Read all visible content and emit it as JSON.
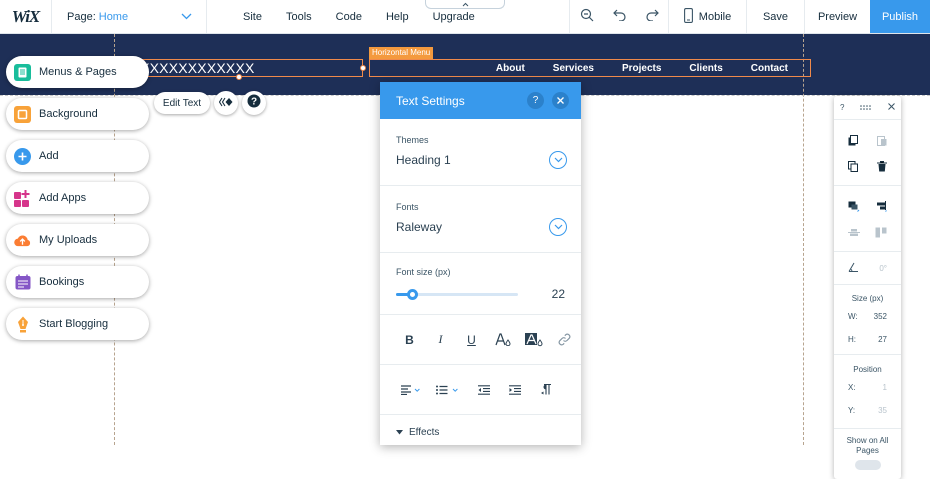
{
  "topbar": {
    "logo": "WiX",
    "page_label": "Page:",
    "page_value": "Home",
    "nav": [
      "Site",
      "Tools",
      "Code",
      "Help",
      "Upgrade"
    ],
    "mobile_label": "Mobile",
    "save_label": "Save",
    "preview_label": "Preview",
    "publish_label": "Publish"
  },
  "site": {
    "text_content": "XXXXXXXXXXXXXX",
    "menu_tag": "Horizontal Menu",
    "menu_items": [
      "About",
      "Services",
      "Projects",
      "Clients",
      "Contact"
    ]
  },
  "floating": {
    "edit_text_label": "Edit Text"
  },
  "left_menu": {
    "items": [
      {
        "label": "Menus & Pages",
        "icon": "pages-icon",
        "color": "#19bd9b"
      },
      {
        "label": "Background",
        "icon": "background-icon",
        "color": "#f8a239"
      },
      {
        "label": "Add",
        "icon": "plus-icon",
        "color": "#3899ec"
      },
      {
        "label": "Add Apps",
        "icon": "apps-icon",
        "color": "#d6358b"
      },
      {
        "label": "My Uploads",
        "icon": "upload-icon",
        "color": "#fb7d33"
      },
      {
        "label": "Bookings",
        "icon": "calendar-icon",
        "color": "#8456c6"
      },
      {
        "label": "Start Blogging",
        "icon": "pen-icon",
        "color": "#f8a239"
      }
    ]
  },
  "text_settings": {
    "title": "Text Settings",
    "help": "?",
    "themes_label": "Themes",
    "themes_value": "Heading 1",
    "fonts_label": "Fonts",
    "fonts_value": "Raleway",
    "font_size_label": "Font size (px)",
    "font_size_value": "22",
    "font_size_fraction": 0.13,
    "effects_label": "Effects"
  },
  "inspector": {
    "help": "?",
    "rotation_value": "0°",
    "size_label": "Size (px)",
    "w_label": "W:",
    "w_value": "352",
    "h_label": "H:",
    "h_value": "27",
    "position_label": "Position",
    "x_label": "X:",
    "x_value": "1",
    "y_label": "Y:",
    "y_value": "35",
    "show_all_label": "Show on All Pages"
  },
  "colors": {
    "accent": "#3899ec",
    "header_bg": "#1e2f57",
    "selection": "#f08a4b"
  }
}
